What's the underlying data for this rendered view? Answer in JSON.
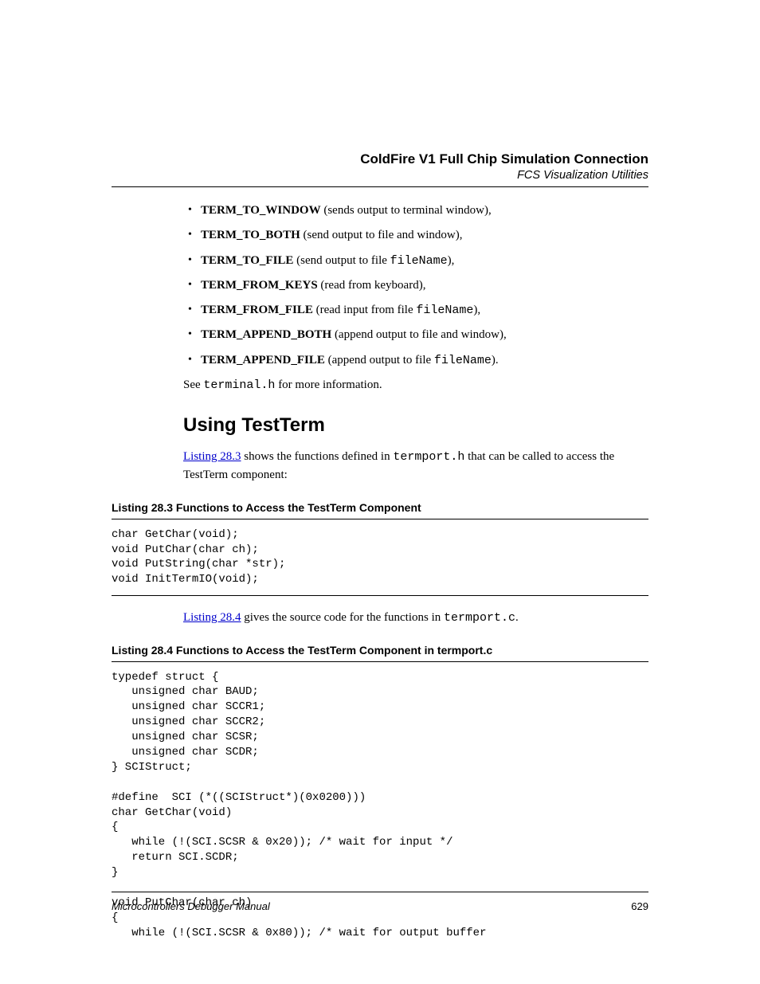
{
  "header": {
    "title": "ColdFire V1 Full Chip Simulation Connection",
    "subtitle": "FCS Visualization Utilities"
  },
  "bullets": [
    {
      "term": "TERM_TO_WINDOW",
      "desc_pre": " (sends output to terminal window),",
      "code": "",
      "desc_post": ""
    },
    {
      "term": "TERM_TO_BOTH",
      "desc_pre": " (send output to file and window),",
      "code": "",
      "desc_post": ""
    },
    {
      "term": "TERM_TO_FILE",
      "desc_pre": " (send output to file ",
      "code": "fileName",
      "desc_post": "),"
    },
    {
      "term": "TERM_FROM_KEYS",
      "desc_pre": " (read from keyboard),",
      "code": "",
      "desc_post": ""
    },
    {
      "term": "TERM_FROM_FILE",
      "desc_pre": " (read input from file ",
      "code": "fileName",
      "desc_post": "),"
    },
    {
      "term": "TERM_APPEND_BOTH",
      "desc_pre": " (append output to file and window),",
      "code": "",
      "desc_post": ""
    },
    {
      "term": "TERM_APPEND_FILE",
      "desc_pre": " (append output to file ",
      "code": "fileName",
      "desc_post": ")."
    }
  ],
  "see": {
    "pre": "See ",
    "code": "terminal.h",
    "post": " for more information."
  },
  "heading": "Using TestTerm",
  "para1": {
    "link": "Listing 28.3",
    "t1": " shows the functions defined in ",
    "code": "termport.h",
    "t2": " that can be called to access the TestTerm component:"
  },
  "listing1": {
    "label": "Listing 28.3  Functions to Access the TestTerm Component",
    "code": "char GetChar(void);\nvoid PutChar(char ch);\nvoid PutString(char *str);\nvoid InitTermIO(void);"
  },
  "para2": {
    "link": "Listing 28.4",
    "t1": " gives the source code for the functions in ",
    "code": "termport.c",
    "t2": "."
  },
  "listing2": {
    "label": "Listing 28.4  Functions to Access the TestTerm Component in termport.c",
    "code": "typedef struct {\n   unsigned char BAUD;\n   unsigned char SCCR1;\n   unsigned char SCCR2;\n   unsigned char SCSR;\n   unsigned char SCDR;\n} SCIStruct;\n\n#define  SCI (*((SCIStruct*)(0x0200)))\nchar GetChar(void)\n{\n   while (!(SCI.SCSR & 0x20)); /* wait for input */\n   return SCI.SCDR;\n}\n\nvoid PutChar(char ch)\n{\n   while (!(SCI.SCSR & 0x80)); /* wait for output buffer"
  },
  "footer": {
    "manual": "Microcontrollers Debugger Manual",
    "page": "629"
  }
}
